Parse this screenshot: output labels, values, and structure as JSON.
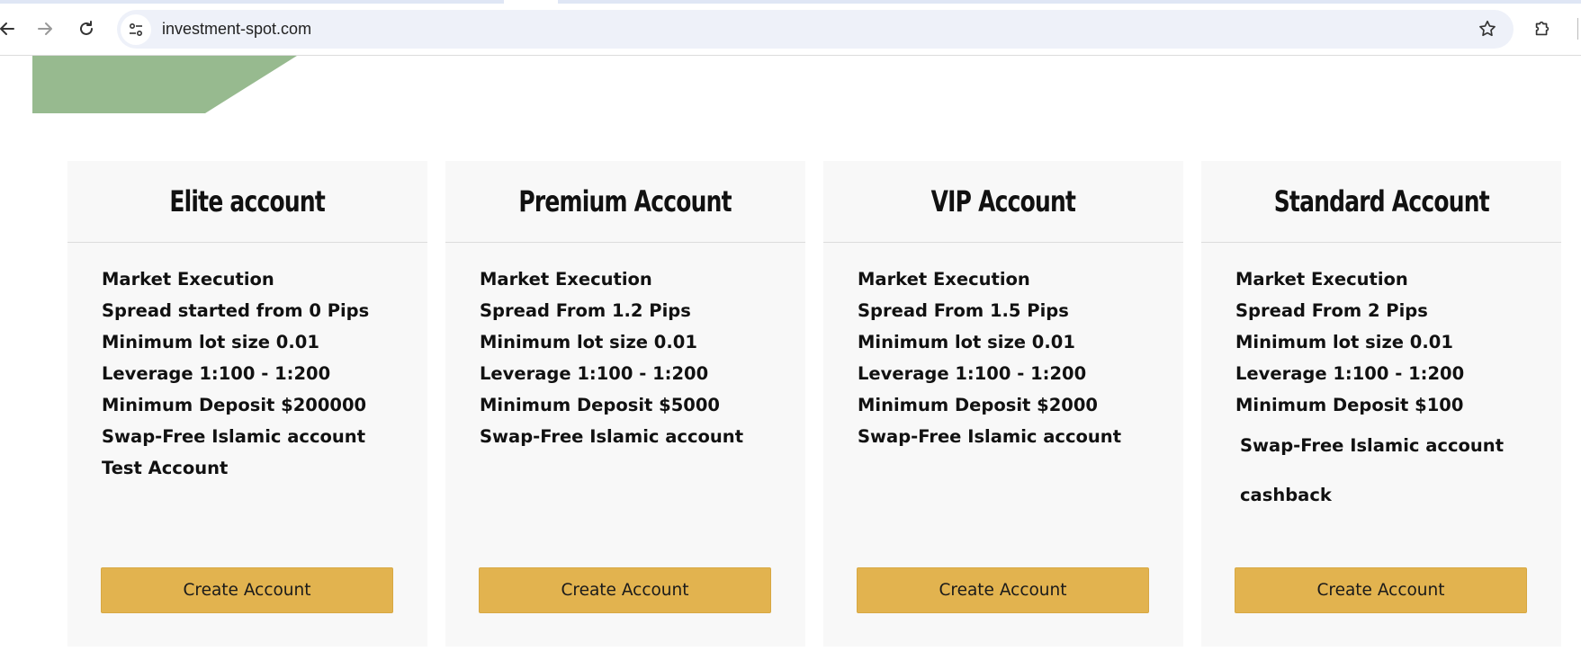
{
  "browser": {
    "url": "investment-spot.com"
  },
  "colors": {
    "deco_green": "#97ba8f",
    "card_bg": "#f8f8f8",
    "button_gold": "#e2b34f"
  },
  "plans": [
    {
      "title": "Elite account",
      "features": [
        "Market Execution",
        "Spread started from 0 Pips",
        "Minimum lot size 0.01",
        "Leverage  1:100 - 1:200",
        "Minimum Deposit $200000",
        "Swap-Free Islamic account Test Account"
      ],
      "button_label": "Create Account"
    },
    {
      "title": "Premium Account",
      "features": [
        "Market Execution",
        "Spread From 1.2 Pips",
        "Minimum lot size 0.01",
        "Leverage 1:100 - 1:200",
        "Minimum Deposit $5000",
        "Swap-Free Islamic account"
      ],
      "button_label": "Create Account"
    },
    {
      "title": "VIP Account",
      "features": [
        "Market Execution",
        "Spread From 1.5 Pips",
        "Minimum lot size 0.01",
        "Leverage  1:100 - 1:200",
        "Minimum Deposit $2000",
        "Swap-Free Islamic account"
      ],
      "button_label": "Create Account"
    },
    {
      "title": "Standard Account",
      "features": [
        "Market Execution",
        "Spread From 2 Pips",
        "Minimum lot size 0.01",
        "Leverage 1:100 - 1:200",
        "Minimum Deposit $100"
      ],
      "extra_features": [
        "Swap-Free Islamic account",
        "cashback"
      ],
      "button_label": "Create Account"
    }
  ]
}
